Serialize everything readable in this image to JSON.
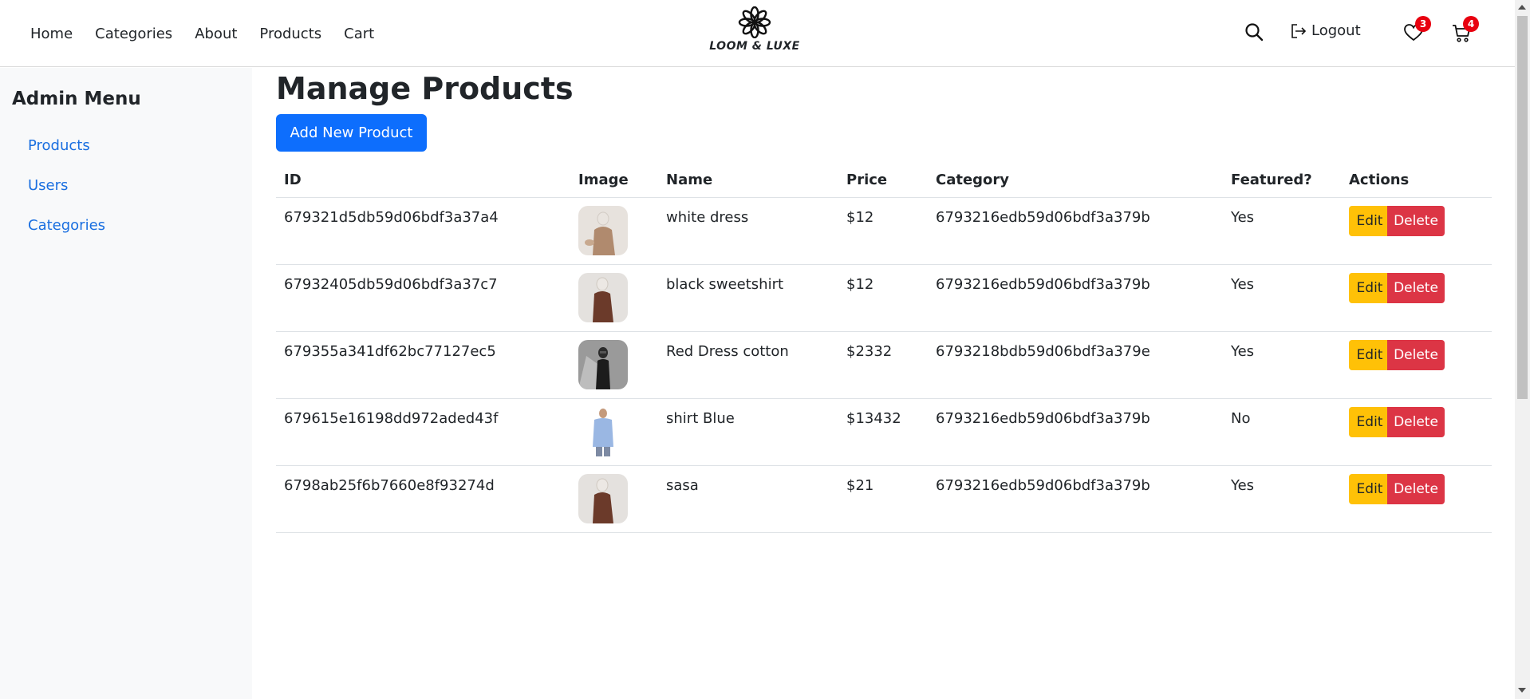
{
  "nav": {
    "links": [
      {
        "label": "Home"
      },
      {
        "label": "Categories"
      },
      {
        "label": "About"
      },
      {
        "label": "Products"
      },
      {
        "label": "Cart"
      }
    ],
    "brand": "LOOM & LUXE",
    "logout_label": "Logout",
    "wishlist_count": "3",
    "cart_count": "4",
    "icons": [
      "search-icon",
      "logout-icon",
      "heart-icon",
      "cart-icon"
    ]
  },
  "sidebar": {
    "title": "Admin Menu",
    "items": [
      {
        "label": "Products"
      },
      {
        "label": "Users"
      },
      {
        "label": "Categories"
      }
    ]
  },
  "main": {
    "title": "Manage Products",
    "add_button": "Add New Product",
    "columns": [
      "ID",
      "Image",
      "Name",
      "Price",
      "Category",
      "Featured?",
      "Actions"
    ],
    "edit_label": "Edit",
    "delete_label": "Delete",
    "rows": [
      {
        "id": "679321d5db59d06bdf3a37a4",
        "name": "white dress",
        "price": "$12",
        "category": "6793216edb59d06bdf3a379b",
        "featured": "Yes"
      },
      {
        "id": "67932405db59d06bdf3a37c7",
        "name": "black sweetshirt",
        "price": "$12",
        "category": "6793216edb59d06bdf3a379b",
        "featured": "Yes"
      },
      {
        "id": "679355a341df62bc77127ec5",
        "name": "Red Dress cotton",
        "price": "$2332",
        "category": "6793218bdb59d06bdf3a379e",
        "featured": "Yes"
      },
      {
        "id": "679615e16198dd972aded43f",
        "name": "shirt Blue",
        "price": "$13432",
        "category": "6793216edb59d06bdf3a379b",
        "featured": "No"
      },
      {
        "id": "6798ab25f6b7660e8f93274d",
        "name": "sasa",
        "price": "$21",
        "category": "6793216edb59d06bdf3a379b",
        "featured": "Yes"
      }
    ]
  },
  "colors": {
    "primary": "#0d6efd",
    "warning": "#ffc107",
    "danger": "#dc3545",
    "link": "#1a6fe0",
    "badge": "#e8000f"
  }
}
